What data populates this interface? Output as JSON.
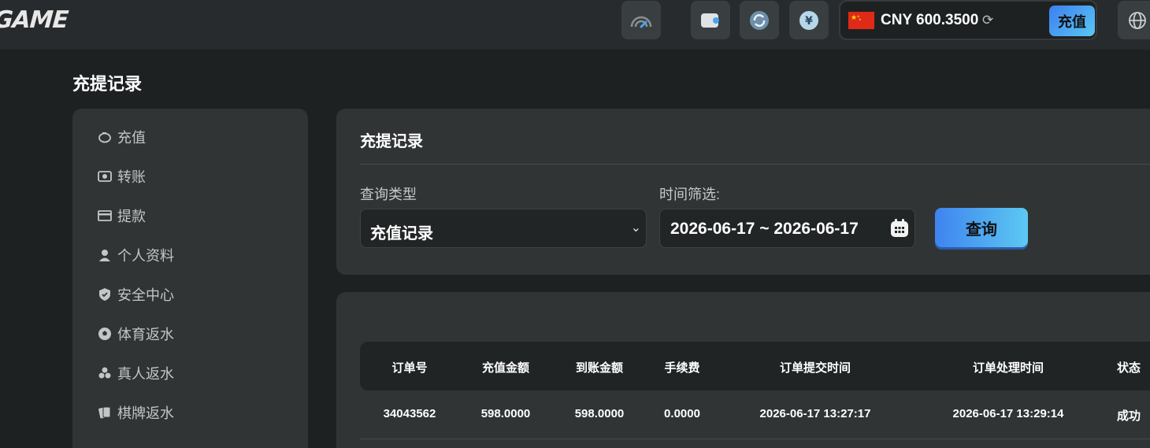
{
  "header": {
    "logo": "GAME",
    "balance_text": "CNY 600.3500",
    "deposit_label": "充值",
    "colors": {
      "accent_start": "#3d7ef0",
      "accent_end": "#59c8f2",
      "flag": "#e02a18"
    },
    "icons": [
      "speedometer-icon",
      "wallet-icon",
      "refresh-icon",
      "yuan-icon",
      "reload-icon",
      "globe-icon"
    ]
  },
  "page_title": "充提记录",
  "sidebar": {
    "items": [
      {
        "label": "充值",
        "icon": "piggy-bank-icon"
      },
      {
        "label": "转账",
        "icon": "transfer-icon"
      },
      {
        "label": "提款",
        "icon": "withdraw-icon"
      },
      {
        "label": "个人资料",
        "icon": "user-icon"
      },
      {
        "label": "安全中心",
        "icon": "shield-icon"
      },
      {
        "label": "体育返水",
        "icon": "soccer-ball-icon"
      },
      {
        "label": "真人返水",
        "icon": "chips-icon"
      },
      {
        "label": "棋牌返水",
        "icon": "cards-icon"
      }
    ]
  },
  "filter": {
    "title": "充提记录",
    "type_label": "查询类型",
    "type_value": "充值记录",
    "date_label": "时间筛选:",
    "date_value": "2026-06-17 ~ 2026-06-17",
    "query_label": "查询"
  },
  "table": {
    "headers": [
      "订单号",
      "充值金额",
      "到账金额",
      "手续费",
      "订单提交时间",
      "订单处理时间",
      "状态"
    ],
    "rows": [
      [
        "34043562",
        "598.0000",
        "598.0000",
        "0.0000",
        "2026-06-17 13:27:17",
        "2026-06-17 13:29:14",
        "成功"
      ]
    ]
  }
}
